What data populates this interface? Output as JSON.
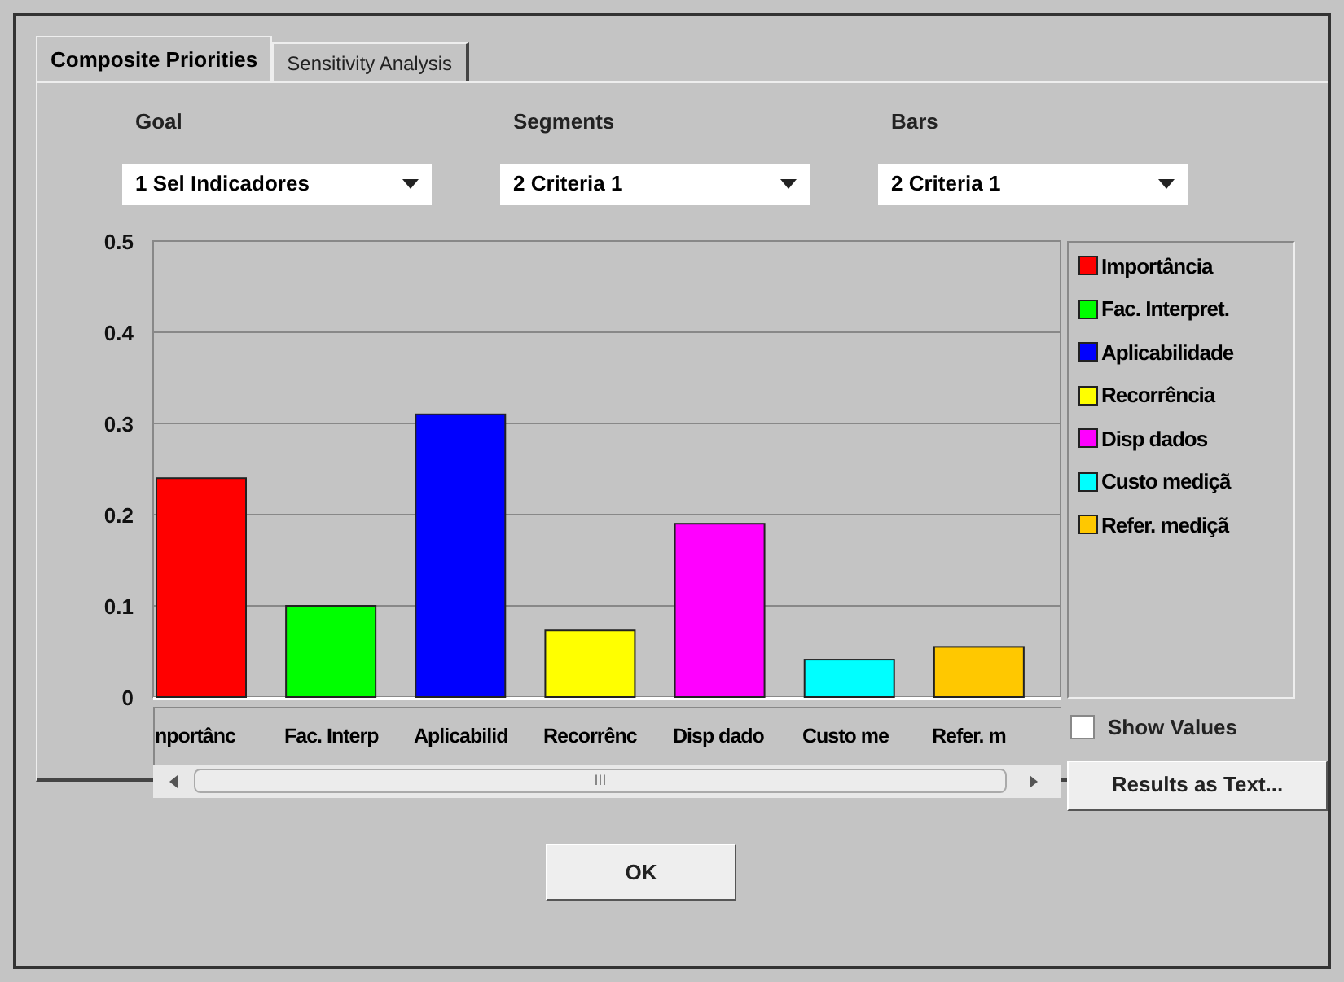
{
  "tabs": [
    {
      "label": "Composite Priorities",
      "selected": true
    },
    {
      "label": "Sensitivity Analysis",
      "selected": false
    }
  ],
  "selectors": [
    {
      "label": "Goal",
      "value": "1 Sel Indicadores"
    },
    {
      "label": "Segments",
      "value": "2 Criteria 1"
    },
    {
      "label": "Bars",
      "value": "2 Criteria 1"
    }
  ],
  "chart": {
    "chart_data": {
      "type": "bar",
      "categories": [
        "nportânc",
        "Fac. Interp",
        "Aplicabilid",
        "Recorrênc",
        "Disp dado",
        "Custo me",
        "Refer. m"
      ],
      "grid": true,
      "series": [
        {
          "values": [
            0.24,
            0.1,
            0.31,
            0.073,
            0.19,
            0.041,
            0.055
          ]
        }
      ],
      "ylim": [
        0,
        0.5
      ],
      "yticks": [
        {
          "value": 0,
          "label": "0"
        },
        0.1,
        0.2,
        0.3,
        0.4,
        0.5
      ]
    }
  },
  "legend": [
    {
      "label": "Importância",
      "color": "#ff0000"
    },
    {
      "label": "Fac. Interpret.",
      "color": "#00ff00"
    },
    {
      "label": "Aplicabilidade",
      "color": "#0000ff"
    },
    {
      "label": "Recorrência",
      "color": "#ffff00"
    },
    {
      "label": "Disp dados",
      "color": "#ff00ff"
    },
    {
      "label": "Custo mediçã",
      "color": "#00ffff"
    },
    {
      "label": "Refer. mediçã",
      "color": "#ffc800"
    }
  ],
  "show_values": {
    "label": "Show Values",
    "checked": false
  },
  "scrollbar": {
    "grip": "III"
  },
  "results_button": "Results as Text...",
  "ok_button": "OK"
}
